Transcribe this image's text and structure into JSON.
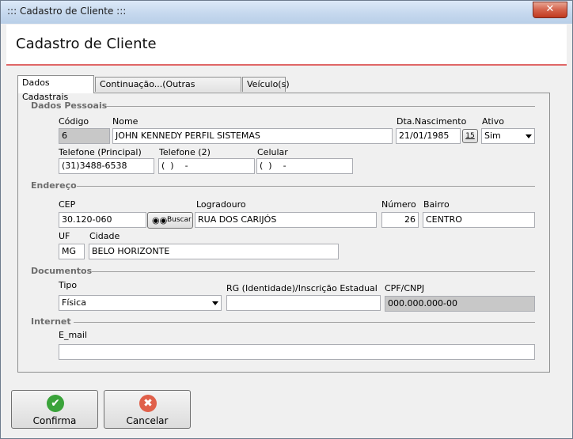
{
  "window": {
    "title": "::: Cadastro de Cliente :::",
    "close_glyph": "✕"
  },
  "header": {
    "title": "Cadastro de Cliente",
    "accent": "#e06666"
  },
  "tabs": [
    {
      "label": "Dados Cadastrais",
      "active": true
    },
    {
      "label": "Continuação...(Outras informações)",
      "active": false
    },
    {
      "label": "Veículo(s)",
      "active": false
    }
  ],
  "pessoais": {
    "section": "Dados Pessoais",
    "codigo_label": "Código",
    "codigo_value": "6",
    "nome_label": "Nome",
    "nome_value": "JOHN KENNEDY PERFIL SISTEMAS",
    "nasc_label": "Dta.Nascimento",
    "nasc_value": "21/01/1985",
    "calendar_glyph": "15",
    "ativo_label": "Ativo",
    "ativo_value": "Sim",
    "tel1_label": "Telefone (Principal)",
    "tel1_value": "(31)3488-6538",
    "tel2_label": "Telefone (2)",
    "tel2_value": "(  )    -",
    "cel_label": "Celular",
    "cel_value": "(  )    -"
  },
  "endereco": {
    "section": "Endereço",
    "cep_label": "CEP",
    "cep_value": "30.120-060",
    "buscar_label": "Buscar",
    "logradouro_label": "Logradouro",
    "logradouro_value": "RUA DOS CARIJÓS",
    "numero_label": "Número",
    "numero_value": "26",
    "bairro_label": "Bairro",
    "bairro_value": "CENTRO",
    "uf_label": "UF",
    "uf_value": "MG",
    "cidade_label": "Cidade",
    "cidade_value": "BELO HORIZONTE"
  },
  "documentos": {
    "section": "Documentos",
    "tipo_label": "Tipo",
    "tipo_value": "Física",
    "rg_label": "RG (Identidade)/Inscrição Estadual",
    "rg_value": "",
    "cpf_label": "CPF/CNPJ",
    "cpf_value": "000.000.000-00"
  },
  "internet": {
    "section": "Internet",
    "email_label": "E_mail",
    "email_value": ""
  },
  "footer": {
    "confirm_label": "Confirma",
    "confirm_color": "#3aa33a",
    "cancel_label": "Cancelar",
    "cancel_color": "#e0604a"
  }
}
